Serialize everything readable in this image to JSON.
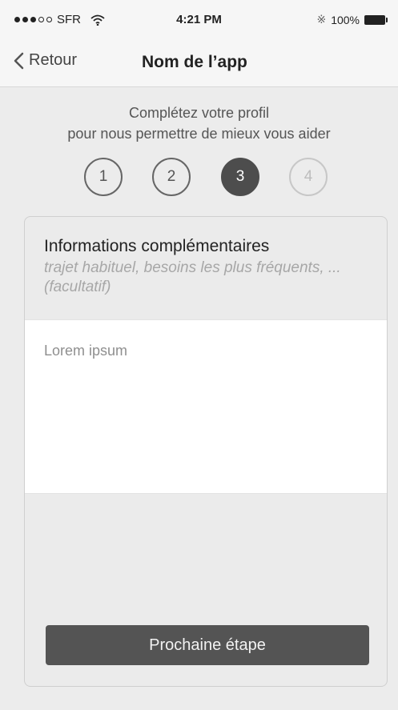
{
  "status_bar": {
    "carrier": "SFR",
    "signal_bars_filled": 3,
    "signal_bars_total": 5,
    "time": "4:21 PM",
    "battery": "100%",
    "icons": {
      "wifi": "wifi-icon",
      "bluetooth": "bluetooth-icon",
      "battery": "battery-icon"
    }
  },
  "nav": {
    "back_label": "Retour",
    "title": "Nom de l’app"
  },
  "intro": {
    "line1": "Complétez votre profil",
    "line2": "pour nous permettre de mieux vous aider"
  },
  "steps": [
    {
      "label": "1",
      "state": "done"
    },
    {
      "label": "2",
      "state": "done"
    },
    {
      "label": "3",
      "state": "current"
    },
    {
      "label": "4",
      "state": "todo"
    }
  ],
  "card": {
    "title": "Informations complémentaires",
    "subtitle": "trajet habituel, besoins les plus fréquents, ... (facultatif)",
    "textarea_value": "Lorem ipsum",
    "next_button_label": "Prochaine étape"
  },
  "colors": {
    "background": "#ececec",
    "primary_dark": "#4d4d4d",
    "muted": "#a7a7a7",
    "white": "#ffffff"
  }
}
